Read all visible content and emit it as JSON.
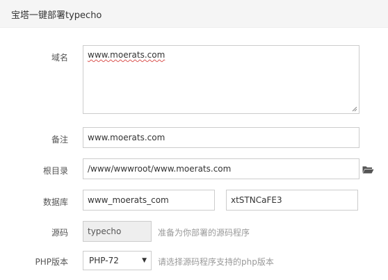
{
  "dialog": {
    "title": "宝塔一键部署typecho"
  },
  "form": {
    "domain": {
      "label": "域名",
      "value": "www.moerats.com"
    },
    "remark": {
      "label": "备注",
      "value": "www.moerats.com"
    },
    "root_dir": {
      "label": "根目录",
      "value": "/www/wwwroot/www.moerats.com",
      "icon": "folder-open-icon"
    },
    "database": {
      "label": "数据库",
      "name": "www_moerats_com",
      "password": "xtSTNCaFE3"
    },
    "source": {
      "label": "源码",
      "value": "typecho",
      "hint": "准备为你部署的源码程序"
    },
    "php": {
      "label": "PHP版本",
      "selected": "PHP-72",
      "hint": "请选择源码程序支持的php版本"
    }
  }
}
